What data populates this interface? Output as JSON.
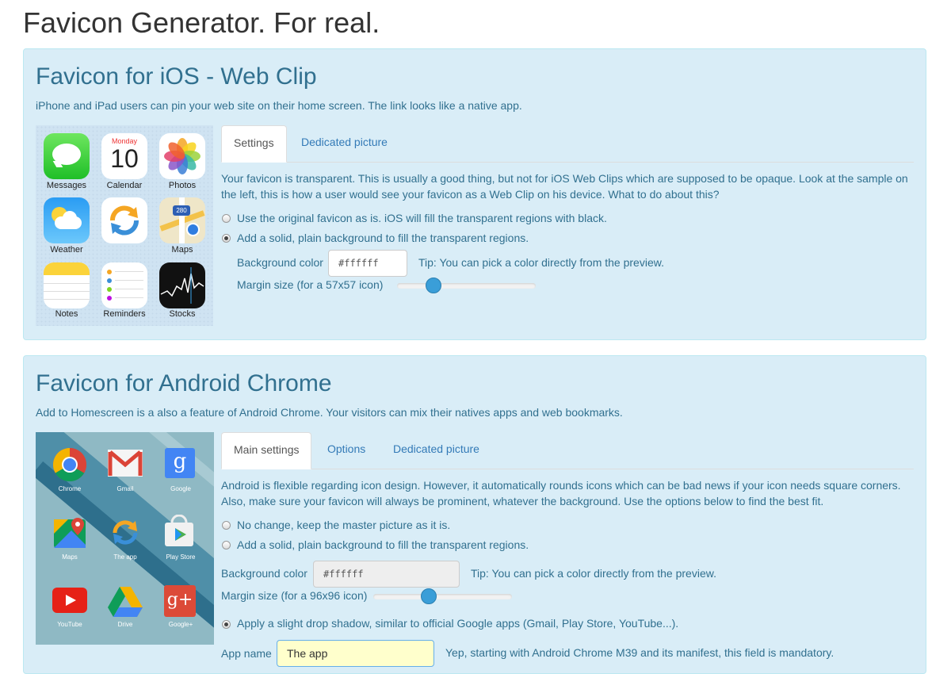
{
  "page_title": "Favicon Generator. For real.",
  "ios": {
    "title": "Favicon for iOS - Web Clip",
    "intro": "iPhone and iPad users can pin your web site on their home screen. The link looks like a native app.",
    "tabs": [
      "Settings",
      "Dedicated picture"
    ],
    "active_tab": "Settings",
    "description": "Your favicon is transparent. This is usually a good thing, but not for iOS Web Clips which are supposed to be opaque. Look at the sample on the left, this is how a user would see your favicon as a Web Clip on his device. What to do about this?",
    "option_original": "Use the original favicon as is. iOS will fill the transparent regions with black.",
    "option_background": "Add a solid, plain background to fill the transparent regions.",
    "background_color_label": "Background color",
    "background_color_value": "#ffffff",
    "tip": "Tip: You can pick a color directly from the preview.",
    "margin_label": "Margin size (for a 57x57 icon)",
    "margin_slider_fraction": 0.26,
    "apps": {
      "messages": "Messages",
      "calendar": "Calendar",
      "photos": "Photos",
      "weather": "Weather",
      "maps": "Maps",
      "notes": "Notes",
      "reminders": "Reminders",
      "stocks": "Stocks",
      "calendar_day": "Monday",
      "calendar_date": "10",
      "maps_shield": "280"
    }
  },
  "android": {
    "title": "Favicon for Android Chrome",
    "intro": "Add to Homescreen is a also a feature of Android Chrome. Your visitors can mix their natives apps and web bookmarks.",
    "tabs": [
      "Main settings",
      "Options",
      "Dedicated picture"
    ],
    "active_tab": "Main settings",
    "description": "Android is flexible regarding icon design. However, it automatically rounds icons which can be bad news if your icon needs square corners. Also, make sure your favicon will always be prominent, whatever the background. Use the options below to find the best fit.",
    "option_no_change": "No change, keep the master picture as it is.",
    "option_background": "Add a solid, plain background to fill the transparent regions.",
    "background_color_label": "Background color",
    "background_color_value": "#ffffff",
    "tip": "Tip: You can pick a color directly from the preview.",
    "margin_label": "Margin size (for a 96x96 icon)",
    "margin_slider_fraction": 0.4,
    "option_shadow": "Apply a slight drop shadow, similar to official Google apps (Gmail, Play Store, YouTube...).",
    "app_name_label": "App name",
    "app_name_value": "The app",
    "app_name_note": "Yep, starting with Android Chrome M39 and its manifest, this field is mandatory.",
    "apps": {
      "chrome": "Chrome",
      "gmail": "Gmail",
      "google": "Google",
      "maps": "Maps",
      "the_app": "The app",
      "play_store": "Play Store",
      "youtube": "YouTube",
      "drive": "Drive",
      "google_plus": "Google+",
      "google_letter": "g",
      "google_plus_letter": "g+"
    }
  },
  "colors": {
    "panel_bg": "#d9edf7",
    "panel_text": "#31708f",
    "link": "#337ab7",
    "slider": "#3a9ed8"
  }
}
